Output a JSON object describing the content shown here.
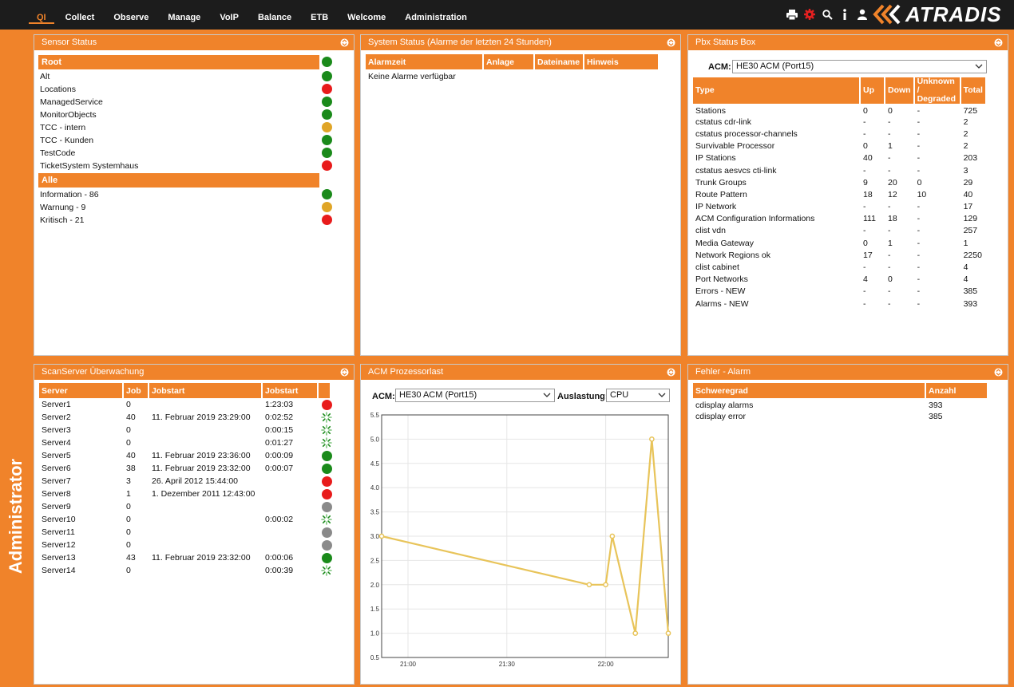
{
  "nav": [
    "QI",
    "Collect",
    "Observe",
    "Manage",
    "VoIP",
    "Balance",
    "ETB",
    "Welcome",
    "Administration"
  ],
  "nav_active": "QI",
  "logo": "ATRADIS",
  "side_label": "Administrator",
  "colors": {
    "accent": "#f0832a",
    "ok": "#1a8a1a",
    "warn": "#e0a527",
    "crit": "#e81b1b",
    "idle": "#8a8a8a",
    "line": "#e8c45a"
  },
  "sensor": {
    "title": "Sensor Status",
    "root_label": "Root",
    "root_status": "ok",
    "items": [
      {
        "label": "Alt",
        "status": "ok"
      },
      {
        "label": "Locations",
        "status": "crit"
      },
      {
        "label": "ManagedService",
        "status": "ok"
      },
      {
        "label": "MonitorObjects",
        "status": "ok"
      },
      {
        "label": "TCC - intern",
        "status": "warn"
      },
      {
        "label": "TCC - Kunden",
        "status": "ok"
      },
      {
        "label": "TestCode",
        "status": "ok"
      },
      {
        "label": "TicketSystem Systemhaus",
        "status": "crit"
      }
    ],
    "all_label": "Alle",
    "all_items": [
      {
        "label": "Information - 86",
        "status": "ok"
      },
      {
        "label": "Warnung - 9",
        "status": "warn"
      },
      {
        "label": "Kritisch - 21",
        "status": "crit"
      }
    ]
  },
  "system": {
    "title": "System Status (Alarme der letzten 24 Stunden)",
    "columns": [
      "Alarmzeit",
      "Anlage",
      "Dateiname",
      "Hinweis"
    ],
    "empty": "Keine Alarme verfügbar"
  },
  "pbx": {
    "title": "Pbx Status Box",
    "acm_label": "ACM:",
    "acm_value": "HE30 ACM (Port15)",
    "columns": [
      "Type",
      "Up",
      "Down",
      "Unknown / Degraded",
      "Total"
    ],
    "rows": [
      [
        "Stations",
        "0",
        "0",
        "-",
        "725"
      ],
      [
        "cstatus cdr-link",
        "-",
        "-",
        "-",
        "2"
      ],
      [
        "cstatus processor-channels",
        "-",
        "-",
        "-",
        "2"
      ],
      [
        "Survivable Processor",
        "0",
        "1",
        "-",
        "2"
      ],
      [
        "IP Stations",
        "40",
        "-",
        "-",
        "203"
      ],
      [
        "cstatus aesvcs cti-link",
        "-",
        "-",
        "-",
        "3"
      ],
      [
        "Trunk Groups",
        "9",
        "20",
        "0",
        "29"
      ],
      [
        "Route Pattern",
        "18",
        "12",
        "10",
        "40"
      ],
      [
        "IP Network",
        "-",
        "-",
        "-",
        "17"
      ],
      [
        "ACM Configuration Informations",
        "111",
        "18",
        "-",
        "129"
      ],
      [
        "clist vdn",
        "-",
        "-",
        "-",
        "257"
      ],
      [
        "Media Gateway",
        "0",
        "1",
        "-",
        "1"
      ],
      [
        "Network Regions ok",
        "17",
        "-",
        "-",
        "2250"
      ],
      [
        "clist cabinet",
        "-",
        "-",
        "-",
        "4"
      ],
      [
        "Port Networks",
        "4",
        "0",
        "-",
        "4"
      ],
      [
        "Errors - NEW",
        "-",
        "-",
        "-",
        "385"
      ],
      [
        "Alarms - NEW",
        "-",
        "-",
        "-",
        "393"
      ]
    ]
  },
  "scan": {
    "title": "ScanServer Überwachung",
    "columns": [
      "Server",
      "Job",
      "Jobstart",
      "Jobstart",
      ""
    ],
    "rows": [
      {
        "server": "Server1",
        "job": "0",
        "start": "",
        "dur": "1:23:03",
        "status": "crit"
      },
      {
        "server": "Server2",
        "job": "40",
        "start": "11. Februar 2019 23:29:00",
        "dur": "0:02:52",
        "status": "spin"
      },
      {
        "server": "Server3",
        "job": "0",
        "start": "",
        "dur": "0:00:15",
        "status": "spin"
      },
      {
        "server": "Server4",
        "job": "0",
        "start": "",
        "dur": "0:01:27",
        "status": "spin"
      },
      {
        "server": "Server5",
        "job": "40",
        "start": "11. Februar 2019 23:36:00",
        "dur": "0:00:09",
        "status": "ok"
      },
      {
        "server": "Server6",
        "job": "38",
        "start": "11. Februar 2019 23:32:00",
        "dur": "0:00:07",
        "status": "ok"
      },
      {
        "server": "Server7",
        "job": "3",
        "start": "26. April 2012 15:44:00",
        "dur": "",
        "status": "crit"
      },
      {
        "server": "Server8",
        "job": "1",
        "start": "1. Dezember 2011 12:43:00",
        "dur": "",
        "status": "crit"
      },
      {
        "server": "Server9",
        "job": "0",
        "start": "",
        "dur": "",
        "status": "idle"
      },
      {
        "server": "Server10",
        "job": "0",
        "start": "",
        "dur": "0:00:02",
        "status": "spin"
      },
      {
        "server": "Server11",
        "job": "0",
        "start": "",
        "dur": "",
        "status": "idle"
      },
      {
        "server": "Server12",
        "job": "0",
        "start": "",
        "dur": "",
        "status": "idle"
      },
      {
        "server": "Server13",
        "job": "43",
        "start": "11. Februar 2019 23:32:00",
        "dur": "0:00:06",
        "status": "ok"
      },
      {
        "server": "Server14",
        "job": "0",
        "start": "",
        "dur": "0:00:39",
        "status": "spin"
      }
    ]
  },
  "acm": {
    "title": "ACM Prozessorlast",
    "acm_label": "ACM:",
    "acm_value": "HE30 ACM (Port15)",
    "load_label": "Auslastung:",
    "load_value": "CPU"
  },
  "fehler": {
    "title": "Fehler - Alarm",
    "columns": [
      "Schweregrad",
      "Anzahl"
    ],
    "rows": [
      [
        "cdisplay alarms",
        "393"
      ],
      [
        "cdisplay error",
        "385"
      ]
    ]
  },
  "chart_data": {
    "type": "line",
    "title": "",
    "xlabel": "",
    "ylabel": "",
    "x": [
      "20:52",
      "21:55",
      "22:00",
      "22:02",
      "22:09",
      "22:14",
      "22:19"
    ],
    "values": [
      3.0,
      2.0,
      2.0,
      3.0,
      1.0,
      5.0,
      1.0
    ],
    "ylim": [
      0.5,
      5.5
    ],
    "xlim": [
      "20:52",
      "22:19"
    ],
    "yticks": [
      "0.5",
      "1.0",
      "1.5",
      "2.0",
      "2.5",
      "3.0",
      "3.5",
      "4.0",
      "4.5",
      "5.0",
      "5.5"
    ],
    "xticks": [
      "21:00",
      "21:30",
      "22:00",
      "22:30"
    ],
    "grid": true
  }
}
